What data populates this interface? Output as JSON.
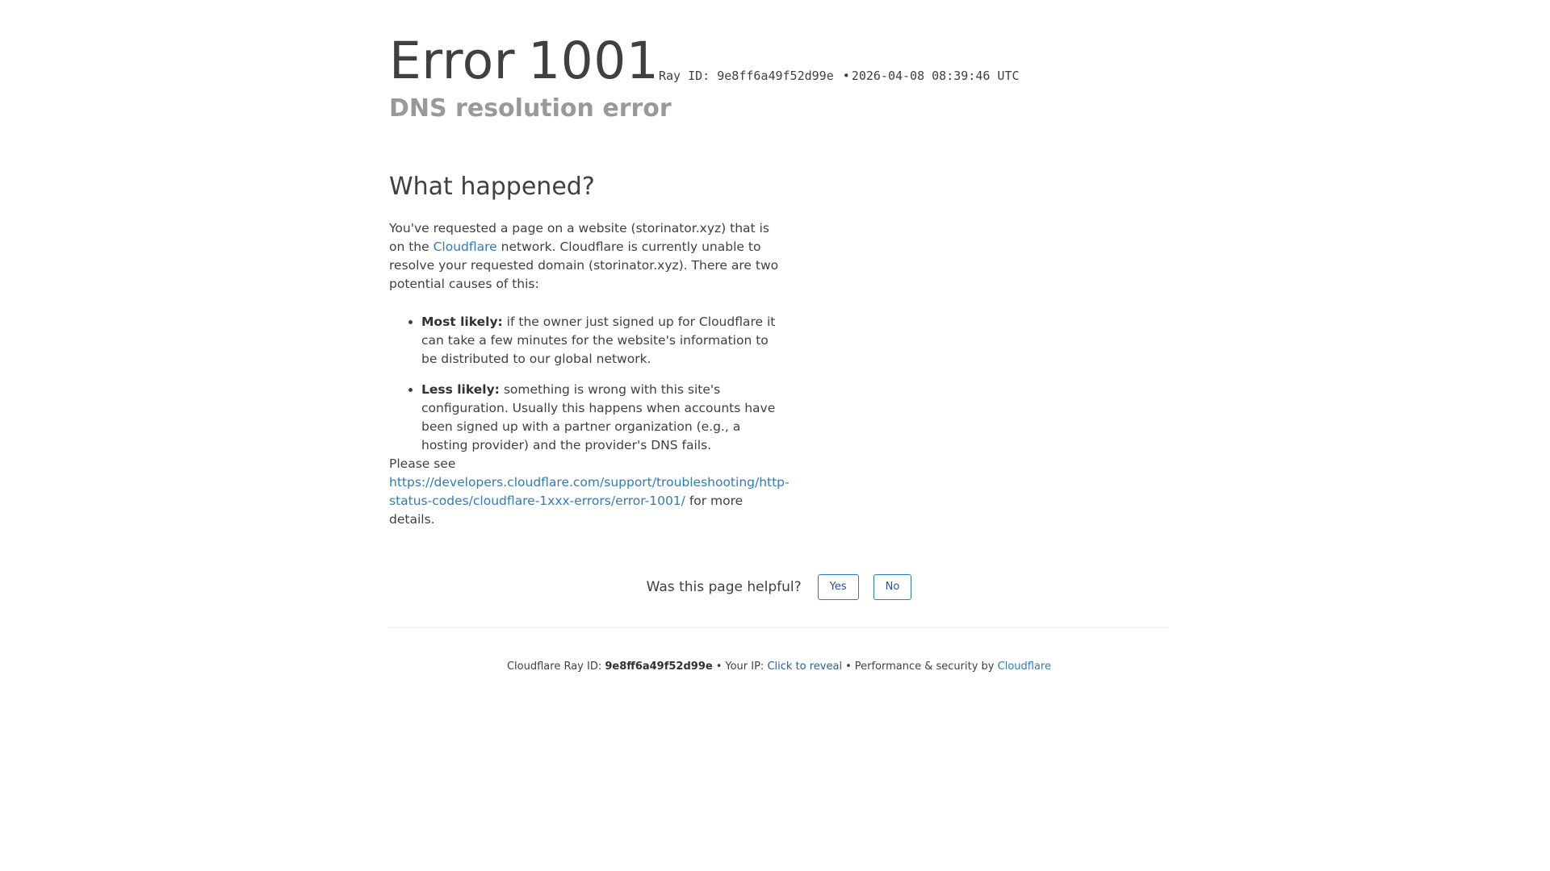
{
  "header": {
    "error_word": "Error",
    "error_code": "1001",
    "ray_id_label": "Ray ID:",
    "ray_id": "9e8ff6a49f52d99e",
    "separator": "•",
    "timestamp": "2026-04-08 08:39:46 UTC",
    "subtitle": "DNS resolution error"
  },
  "what_happened": {
    "heading": "What happened?",
    "intro_part1": "You've requested a page on a website (storinator.xyz) that is on the ",
    "intro_link": "Cloudflare",
    "intro_part2": " network. Cloudflare is currently unable to resolve your requested domain (storinator.xyz). There are two potential causes of this:",
    "causes": [
      {
        "label": "Most likely:",
        "text": " if the owner just signed up for Cloudflare it can take a few minutes for the website's information to be distributed to our global network."
      },
      {
        "label": "Less likely:",
        "text": " something is wrong with this site's configuration. Usually this happens when accounts have been signed up with a partner organization (e.g., a hosting provider) and the provider's DNS fails."
      }
    ],
    "see_prefix": "Please see ",
    "see_link": "https://developers.cloudflare.com/support/troubleshooting/http-status-codes/cloudflare-1xxx-errors/error-1001/",
    "see_suffix": " for more details."
  },
  "feedback": {
    "question": "Was this page helpful?",
    "yes_label": "Yes",
    "no_label": "No"
  },
  "footer": {
    "ray_label": "Cloudflare Ray ID:",
    "ray_id": "9e8ff6a49f52d99e",
    "bullet": "•",
    "ip_label": "Your IP:",
    "ip_link": "Click to reveal",
    "perf_label": "Performance & security by",
    "perf_link": "Cloudflare"
  },
  "colors": {
    "link": "#2f7bbf",
    "text": "#404040",
    "muted": "#999999"
  }
}
